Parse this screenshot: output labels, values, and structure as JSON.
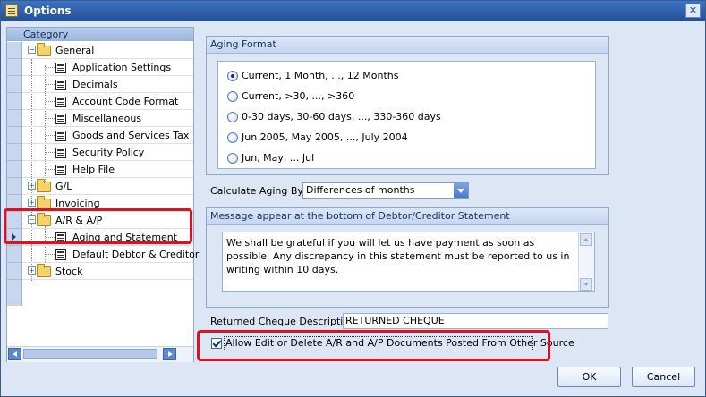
{
  "window": {
    "title": "Options",
    "close_glyph": "✕"
  },
  "tree": {
    "header": "Category",
    "nodes": [
      {
        "label": "General",
        "type": "folder",
        "expanded": true
      },
      {
        "label": "Application Settings",
        "type": "doc"
      },
      {
        "label": "Decimals",
        "type": "doc"
      },
      {
        "label": "Account Code Format",
        "type": "doc"
      },
      {
        "label": "Miscellaneous",
        "type": "doc"
      },
      {
        "label": "Goods and Services Tax",
        "type": "doc"
      },
      {
        "label": "Security Policy",
        "type": "doc"
      },
      {
        "label": "Help File",
        "type": "doc"
      },
      {
        "label": "G/L",
        "type": "folder",
        "expanded": false
      },
      {
        "label": "Invoicing",
        "type": "folder",
        "expanded": false
      },
      {
        "label": "A/R & A/P",
        "type": "folder",
        "expanded": true
      },
      {
        "label": "Aging and Statement",
        "type": "doc",
        "selected": true
      },
      {
        "label": "Default Debtor & Creditor",
        "type": "doc"
      },
      {
        "label": "Stock",
        "type": "folder",
        "expanded": false
      }
    ]
  },
  "aging_format": {
    "title": "Aging Format",
    "options": [
      {
        "label": "Current, 1 Month, ..., 12 Months",
        "checked": true
      },
      {
        "label": "Current, >30, ..., >360",
        "checked": false
      },
      {
        "label": "0-30 days, 30-60 days, ..., 330-360 days",
        "checked": false
      },
      {
        "label": "Jun 2005, May 2005, ..., July 2004",
        "checked": false
      },
      {
        "label": "Jun, May, ... Jul",
        "checked": false
      }
    ]
  },
  "calculate_aging": {
    "label": "Calculate Aging By:",
    "value": "Differences of months"
  },
  "message": {
    "title": "Message appear at the bottom of Debtor/Creditor Statement",
    "text": "We shall be grateful if you will let us have payment as soon as possible. Any discrepancy in this statement must be reported to us in writing within 10 days."
  },
  "returned_cheque": {
    "label": "Returned Cheque Description",
    "value": "RETURNED CHEQUE"
  },
  "allow_edit": {
    "label": "Allow Edit or Delete A/R and A/P Documents Posted From Other Source",
    "checked": true
  },
  "buttons": {
    "ok": "OK",
    "cancel": "Cancel"
  },
  "colors": {
    "highlight": "#e0101c",
    "title_bar": "#2f5ea8",
    "panel": "#dce6f4"
  }
}
